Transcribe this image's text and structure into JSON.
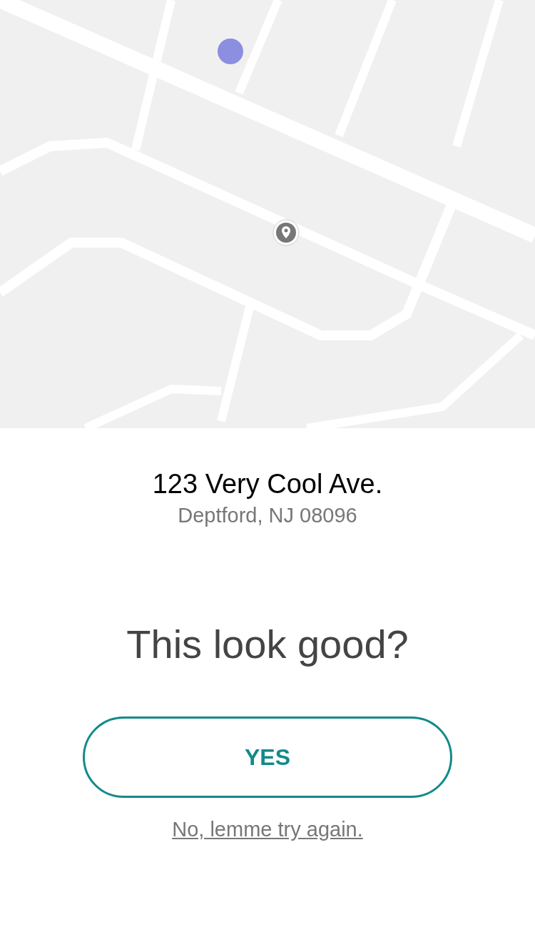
{
  "address": {
    "line1": "123 Very Cool Ave.",
    "line2": "Deptford, NJ 08096"
  },
  "prompt": "This look good?",
  "buttons": [
    {
      "kind": "primary",
      "label": "YES"
    },
    {
      "kind": "link",
      "label": "No, lemme try again."
    }
  ]
}
